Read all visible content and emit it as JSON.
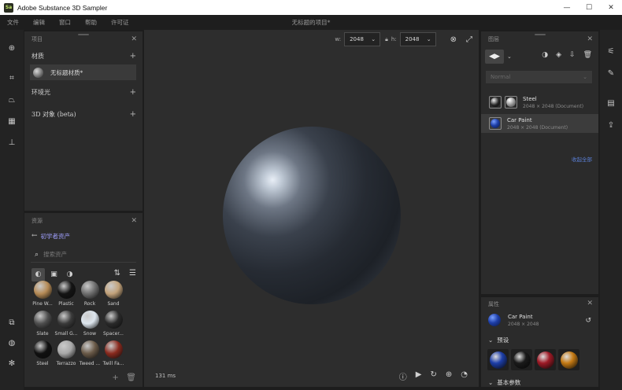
{
  "window": {
    "title": "Adobe Substance 3D Sampler",
    "logo_text": "Sa",
    "controls": [
      "—",
      "☐",
      "✕"
    ]
  },
  "menu": {
    "items": [
      "文件",
      "编辑",
      "窗口",
      "帮助",
      "许可证"
    ],
    "document_title": "无标题的项目*"
  },
  "left_rail": {
    "icons": [
      "add-icon",
      "crop-icon",
      "perspective-icon",
      "grid-icon",
      "stamp-icon",
      "layers-icon",
      "palette-icon",
      "settings-icon"
    ]
  },
  "project_panel": {
    "title": "项目",
    "sections": [
      {
        "label": "材质",
        "add": "+"
      },
      {
        "label": "环境光",
        "add": "+"
      },
      {
        "label": "3D 对象 (beta)",
        "add": "+"
      }
    ],
    "material_item": "无标题材质*"
  },
  "assets_panel": {
    "title": "资源",
    "back_label": "初学者资产",
    "search_placeholder": "搜索资产",
    "assets": [
      {
        "name": "Pine W...",
        "color": "#b58a55"
      },
      {
        "name": "Plastic",
        "color": "#141414"
      },
      {
        "name": "Rock",
        "color": "#6e6e6e"
      },
      {
        "name": "Sand",
        "color": "#c2a27a"
      },
      {
        "name": "Slate",
        "color": "#4e4e4e"
      },
      {
        "name": "Small G...",
        "color": "#3a3a3a"
      },
      {
        "name": "Snow",
        "color": "#dde6ee"
      },
      {
        "name": "Spacer...",
        "color": "#2a2a2a"
      },
      {
        "name": "Steel",
        "color": "#101010"
      },
      {
        "name": "Terrazzo",
        "color": "#a8a8a8"
      },
      {
        "name": "Tweed ...",
        "color": "#6a5a48"
      },
      {
        "name": "Twill Fa...",
        "color": "#8a2a1e"
      }
    ]
  },
  "viewport": {
    "w_label": "w:",
    "w_value": "2048",
    "h_label": "h:",
    "h_value": "2048",
    "render_time": "131 ms"
  },
  "layers_panel": {
    "title": "图层",
    "blend_mode": "Normal",
    "layers": [
      {
        "name": "Steel",
        "size": "2048 × 2048 (Document)",
        "color": "#111111"
      },
      {
        "name": "Car Paint",
        "size": "2048 × 2048 (Document)",
        "color": "#1d3ea8"
      }
    ],
    "link_text": "收起全部"
  },
  "properties_panel": {
    "title": "属性",
    "name": "Car Paint",
    "size": "2048 × 2048",
    "presets_label": "预设",
    "presets": [
      "#1d3ea8",
      "#1a1a1a",
      "#9e1a26",
      "#c47a14"
    ],
    "next_section": "基本参数"
  }
}
